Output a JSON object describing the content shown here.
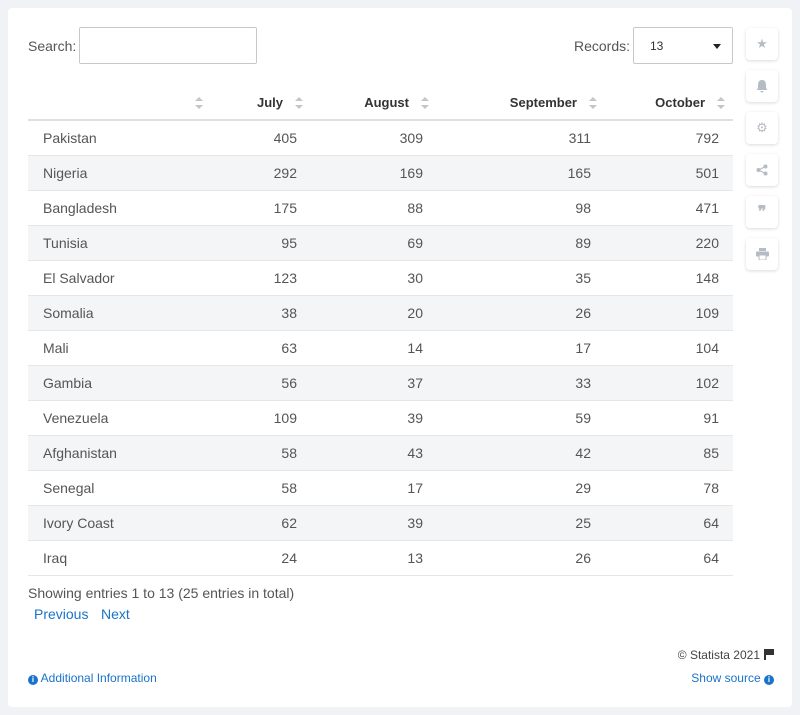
{
  "search": {
    "label": "Search:",
    "value": ""
  },
  "records": {
    "label": "Records:",
    "selected": "13"
  },
  "table": {
    "headers": [
      "",
      "July",
      "August",
      "September",
      "October"
    ],
    "rows": [
      [
        "Pakistan",
        "405",
        "309",
        "311",
        "792"
      ],
      [
        "Nigeria",
        "292",
        "169",
        "165",
        "501"
      ],
      [
        "Bangladesh",
        "175",
        "88",
        "98",
        "471"
      ],
      [
        "Tunisia",
        "95",
        "69",
        "89",
        "220"
      ],
      [
        "El Salvador",
        "123",
        "30",
        "35",
        "148"
      ],
      [
        "Somalia",
        "38",
        "20",
        "26",
        "109"
      ],
      [
        "Mali",
        "63",
        "14",
        "17",
        "104"
      ],
      [
        "Gambia",
        "56",
        "37",
        "33",
        "102"
      ],
      [
        "Venezuela",
        "109",
        "39",
        "59",
        "91"
      ],
      [
        "Afghanistan",
        "58",
        "43",
        "42",
        "85"
      ],
      [
        "Senegal",
        "58",
        "17",
        "29",
        "78"
      ],
      [
        "Ivory Coast",
        "62",
        "39",
        "25",
        "64"
      ],
      [
        "Iraq",
        "24",
        "13",
        "26",
        "64"
      ]
    ]
  },
  "footer": {
    "info": "Showing entries 1 to 13 (25 entries in total)",
    "previous": "Previous",
    "next": "Next",
    "copyright": "© Statista 2021",
    "additional_info": "Additional Information",
    "show_source": "Show source"
  },
  "side_tools": [
    "star-icon",
    "bell-icon",
    "gear-icon",
    "share-icon",
    "quote-icon",
    "print-icon"
  ],
  "colors": {
    "link": "#1a73c8",
    "row_alt": "#f3f5f7"
  }
}
